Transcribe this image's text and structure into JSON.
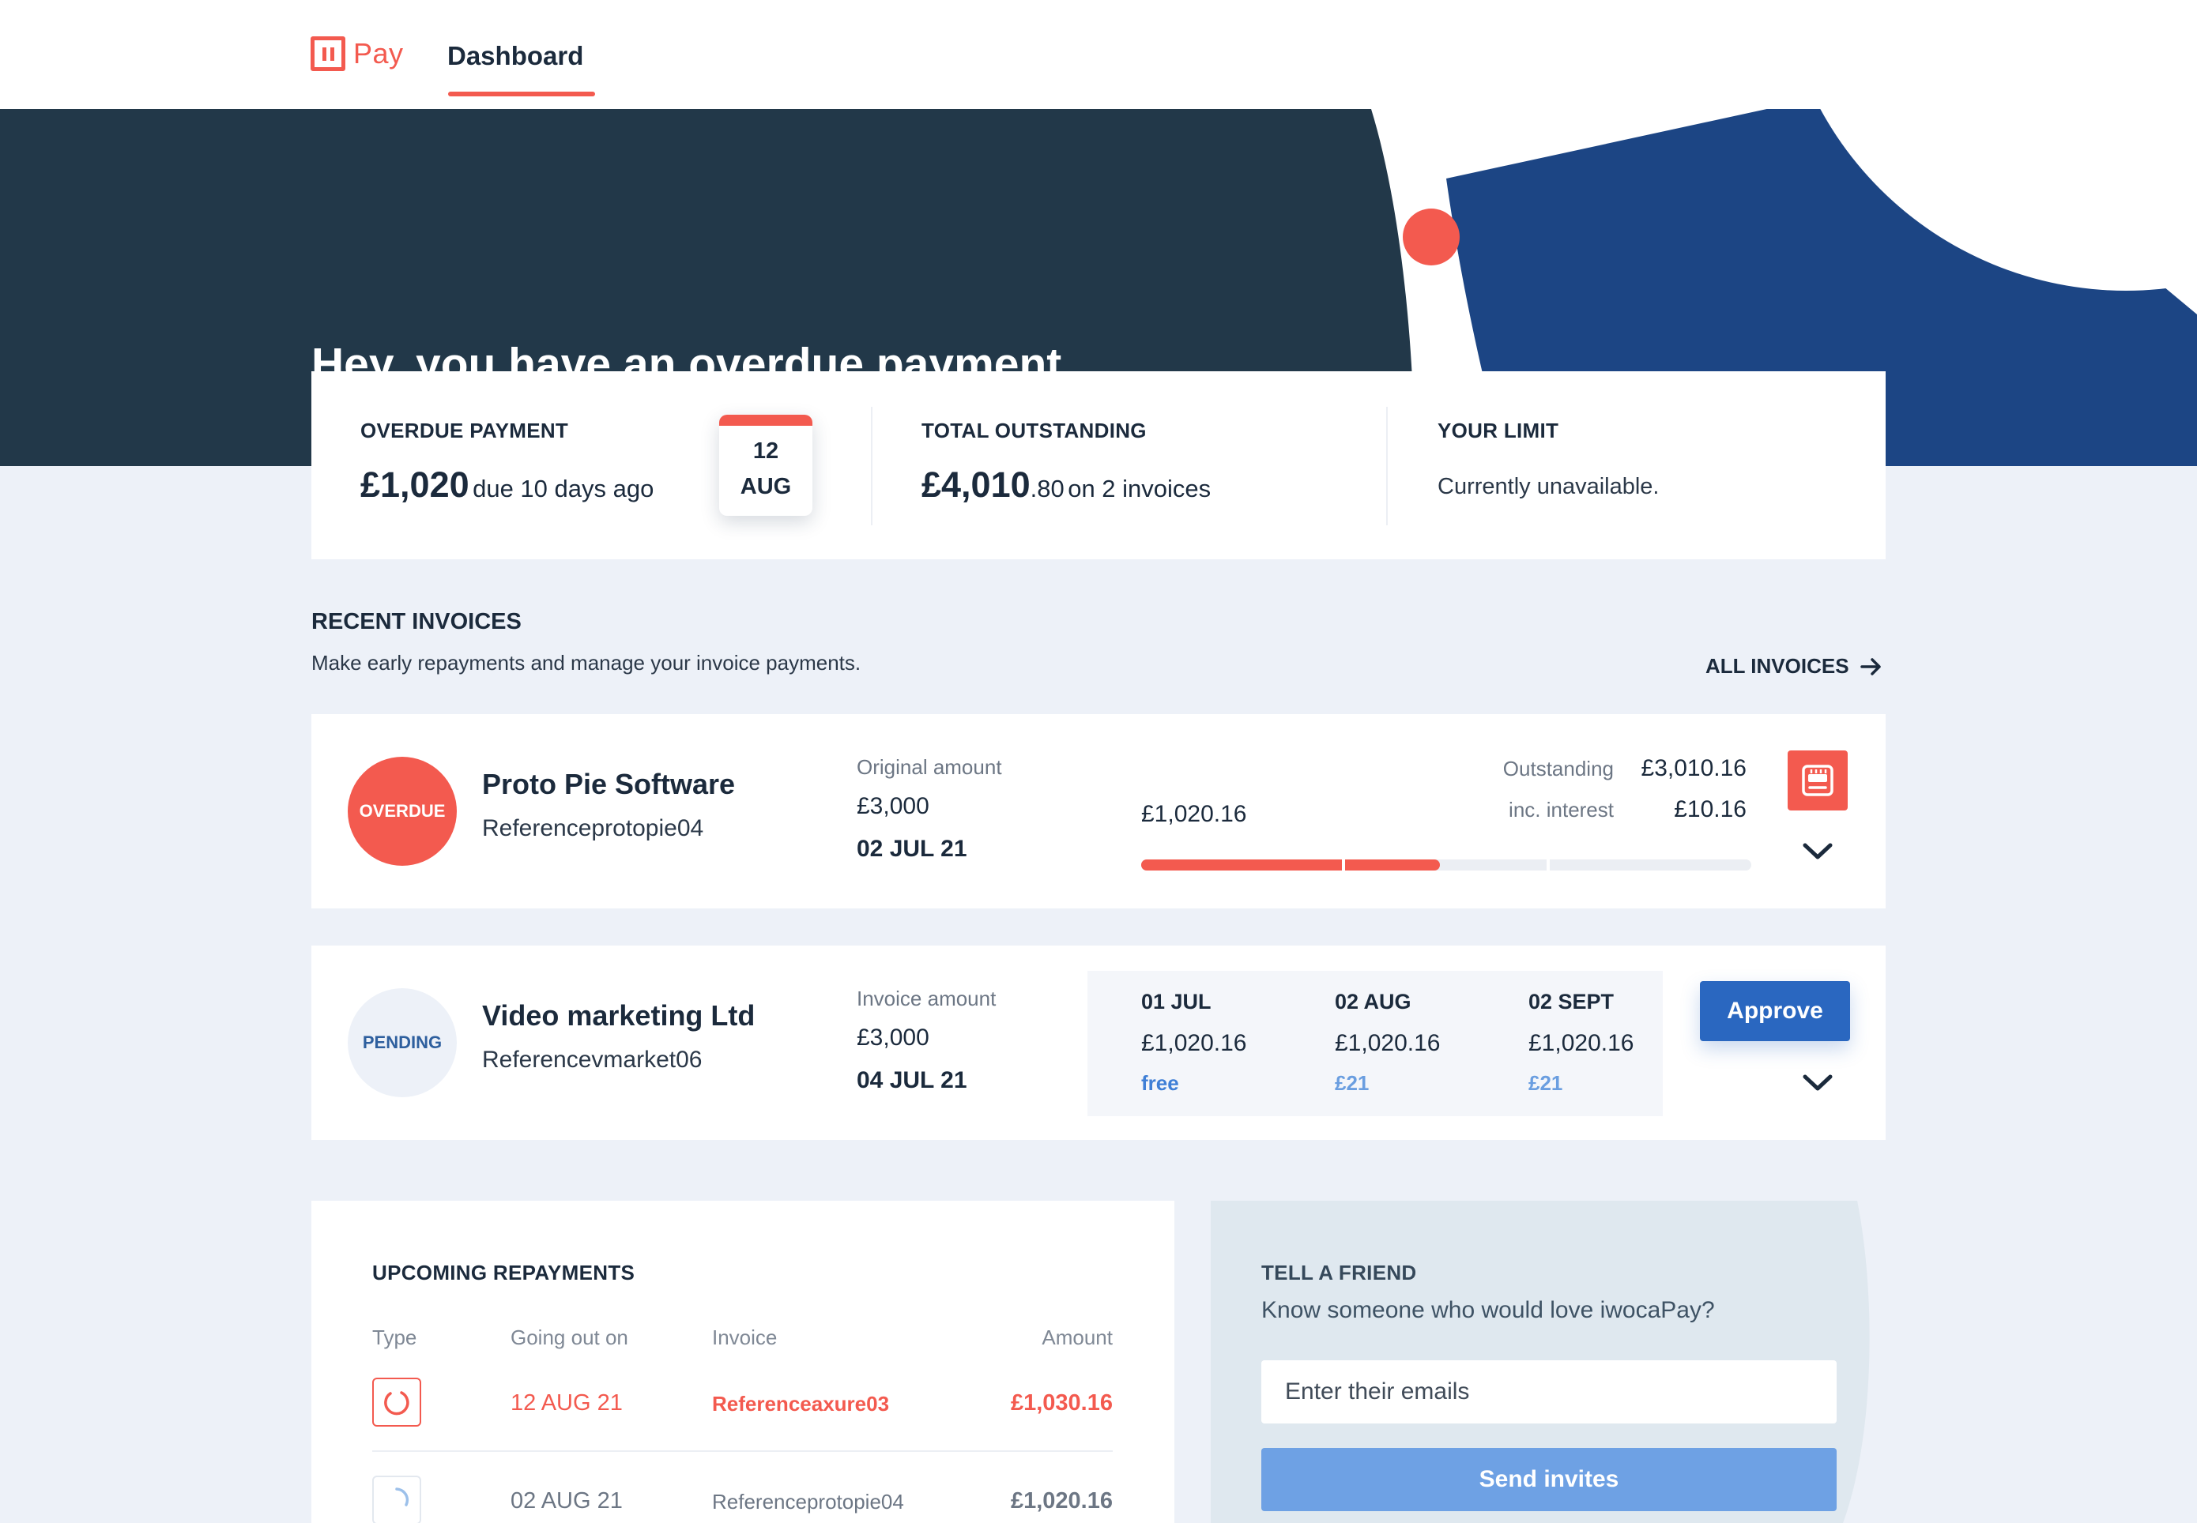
{
  "brand": {
    "name": "Pay",
    "accent": "#f35a4f",
    "navy": "#223849",
    "blue": "#2a67c0"
  },
  "nav": {
    "active_tab": "Dashboard"
  },
  "hero": {
    "title": "Hey, you have an overdue payment"
  },
  "summary": {
    "overdue": {
      "label": "OVERDUE PAYMENT",
      "amount": "£1,020",
      "note": "due 10 days ago",
      "cal_day": "12",
      "cal_month": "AUG"
    },
    "outstanding": {
      "label": "TOTAL OUTSTANDING",
      "amount_main": "£4,010",
      "amount_pence": ".80",
      "note": "on 2 invoices"
    },
    "limit": {
      "label": "YOUR LIMIT",
      "value": "Currently unavailable."
    }
  },
  "recent": {
    "title": "RECENT INVOICES",
    "subtitle": "Make early repayments and manage your invoice payments.",
    "all_link": "ALL INVOICES"
  },
  "invoices": [
    {
      "status": "OVERDUE",
      "name": "Proto Pie Software",
      "ref": "Referenceprotopie04",
      "amount_label": "Original amount",
      "amount": "£3,000",
      "date": "02 JUL 21",
      "mid_amount": "£1,020.16",
      "outstanding_label": "Outstanding",
      "outstanding_value": "£3,010.16",
      "interest_label": "inc. interest",
      "interest_value": "£10.16",
      "progress_paid_fraction": 0.49
    },
    {
      "status": "PENDING",
      "name": "Video marketing Ltd",
      "ref": "Referencevmarket06",
      "amount_label": "Invoice amount",
      "amount": "£3,000",
      "date": "04 JUL 21",
      "schedule": [
        {
          "date": "01 JUL",
          "amount": "£1,020.16",
          "fee": "free"
        },
        {
          "date": "02 AUG",
          "amount": "£1,020.16",
          "fee": "£21"
        },
        {
          "date": "02 SEPT",
          "amount": "£1,020.16",
          "fee": "£21"
        }
      ],
      "approve_label": "Approve"
    }
  ],
  "upcoming": {
    "title": "UPCOMING REPAYMENTS",
    "headers": {
      "type": "Type",
      "going_out": "Going out on",
      "invoice": "Invoice",
      "amount": "Amount"
    },
    "rows": [
      {
        "date": "12 AUG 21",
        "invoice": "Referenceaxure03",
        "amount": "£1,030.16",
        "highlight": true
      },
      {
        "date": "02 AUG 21",
        "invoice": "Referenceprotopie04",
        "amount": "£1,020.16",
        "highlight": false
      }
    ]
  },
  "friend": {
    "title": "TELL A FRIEND",
    "subtitle": "Know someone who would love iwocaPay?",
    "placeholder": "Enter their emails",
    "button": "Send invites"
  }
}
